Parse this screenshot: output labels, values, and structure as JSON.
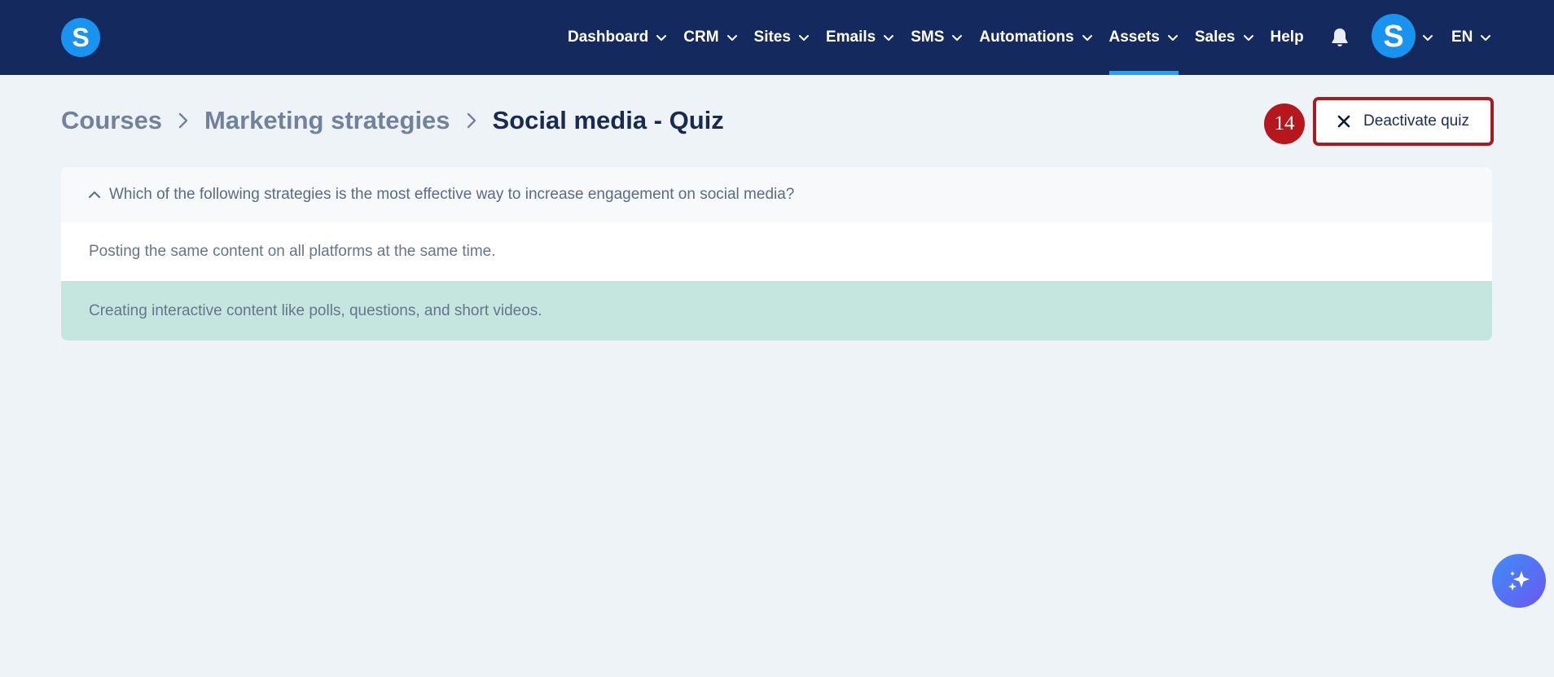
{
  "brand": {
    "logo_letter": "S"
  },
  "nav": {
    "items": [
      {
        "label": "Dashboard",
        "has_dropdown": true,
        "active": false
      },
      {
        "label": "CRM",
        "has_dropdown": true,
        "active": false
      },
      {
        "label": "Sites",
        "has_dropdown": true,
        "active": false
      },
      {
        "label": "Emails",
        "has_dropdown": true,
        "active": false
      },
      {
        "label": "SMS",
        "has_dropdown": true,
        "active": false
      },
      {
        "label": "Automations",
        "has_dropdown": true,
        "active": false
      },
      {
        "label": "Assets",
        "has_dropdown": true,
        "active": true
      },
      {
        "label": "Sales",
        "has_dropdown": true,
        "active": false
      },
      {
        "label": "Help",
        "has_dropdown": false,
        "active": false
      }
    ],
    "notifications_icon": "bell-icon",
    "avatar_letter": "S",
    "language": "EN"
  },
  "breadcrumb": {
    "items": [
      "Courses",
      "Marketing strategies"
    ],
    "current": "Social media - Quiz"
  },
  "toolbar": {
    "step_number": "14",
    "deactivate_label": "Deactivate quiz"
  },
  "quiz": {
    "question": "Which of the following strategies is the most effective way to increase engagement on social media?",
    "answers": [
      {
        "text": "Posting the same content on all platforms at the same time.",
        "correct": false
      },
      {
        "text": "Creating interactive content like polls, questions, and short videos.",
        "correct": true
      }
    ]
  },
  "colors": {
    "nav_background": "#142a5e",
    "accent": "#1893ef",
    "active_underline": "#1fa3f5",
    "correct_answer_bg": "#c4e6df",
    "highlight_border": "#a51c22",
    "step_badge": "#b5171d"
  }
}
